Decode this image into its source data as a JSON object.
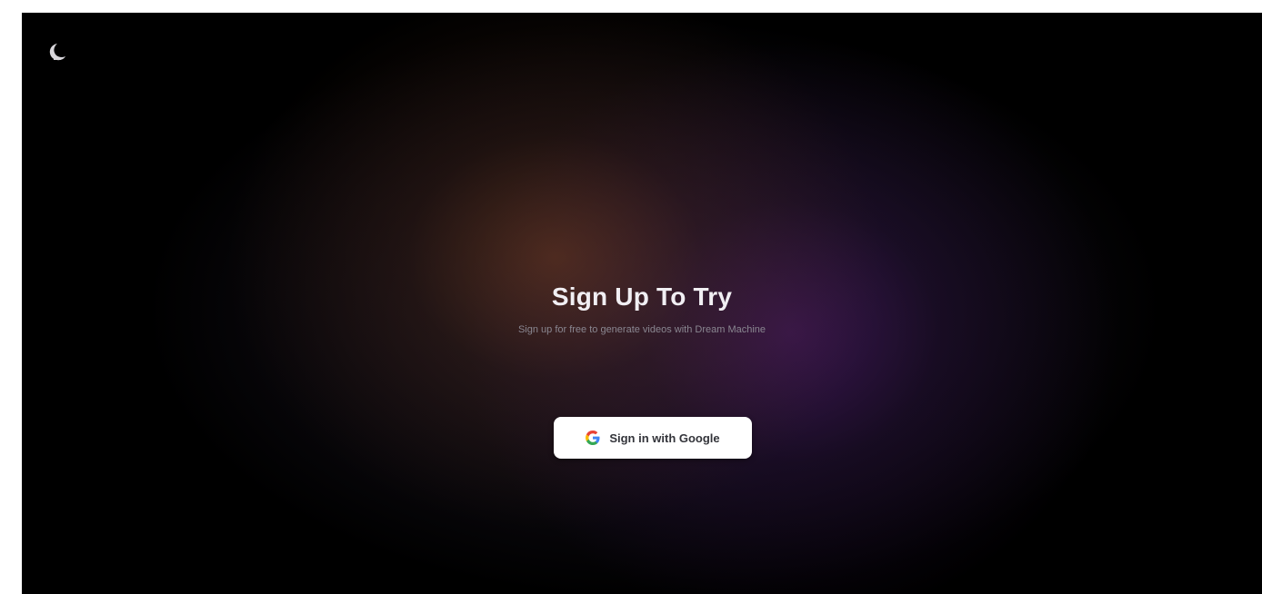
{
  "page": {
    "logo_icon": "moon-logo-icon",
    "title": "Sign Up To Try",
    "subtitle": "Sign up for free to generate videos with Dream Machine"
  },
  "auth": {
    "google_button_label": "Sign in with Google",
    "google_icon": "google-icon"
  },
  "colors": {
    "background": "#000000",
    "glow_warm": "#783e1e",
    "glow_purple": "#4e186e",
    "title": "#f1eff3",
    "subtitle": "#8a8791",
    "button_bg": "#ffffff"
  }
}
